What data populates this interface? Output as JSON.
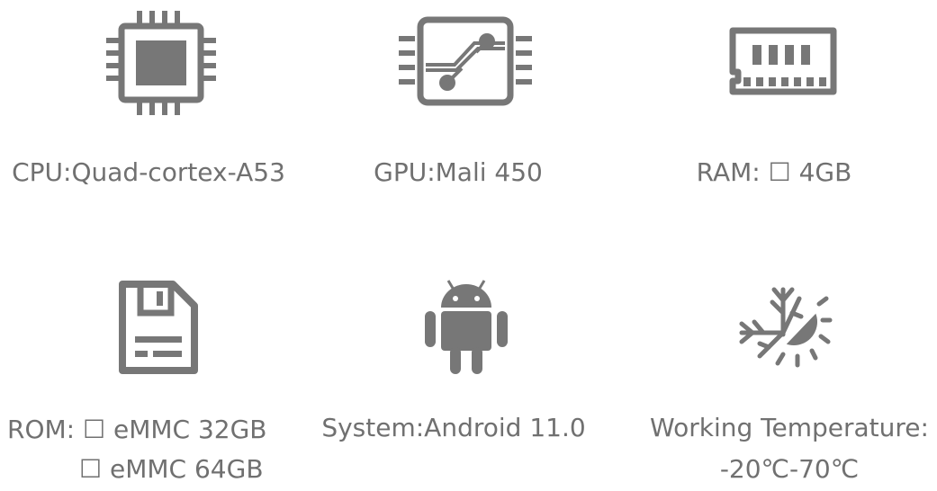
{
  "specs": {
    "cpu": "CPU:Quad-cortex-A53",
    "gpu": "GPU:Mali 450",
    "ram": "RAM: ☐ 4GB",
    "rom_line1": "ROM: ☐ eMMC 32GB",
    "rom_line2": "☐ eMMC 64GB",
    "system": "System:Android 11.0",
    "temp_line1": "Working Temperature:",
    "temp_line2": "-20℃-70℃"
  },
  "icons": [
    "cpu-chip-icon",
    "gpu-chip-icon",
    "ram-module-icon",
    "floppy-disk-icon",
    "android-icon",
    "snow-sun-temperature-icon"
  ],
  "colors": {
    "icon": "#777777",
    "text": "#707070"
  }
}
